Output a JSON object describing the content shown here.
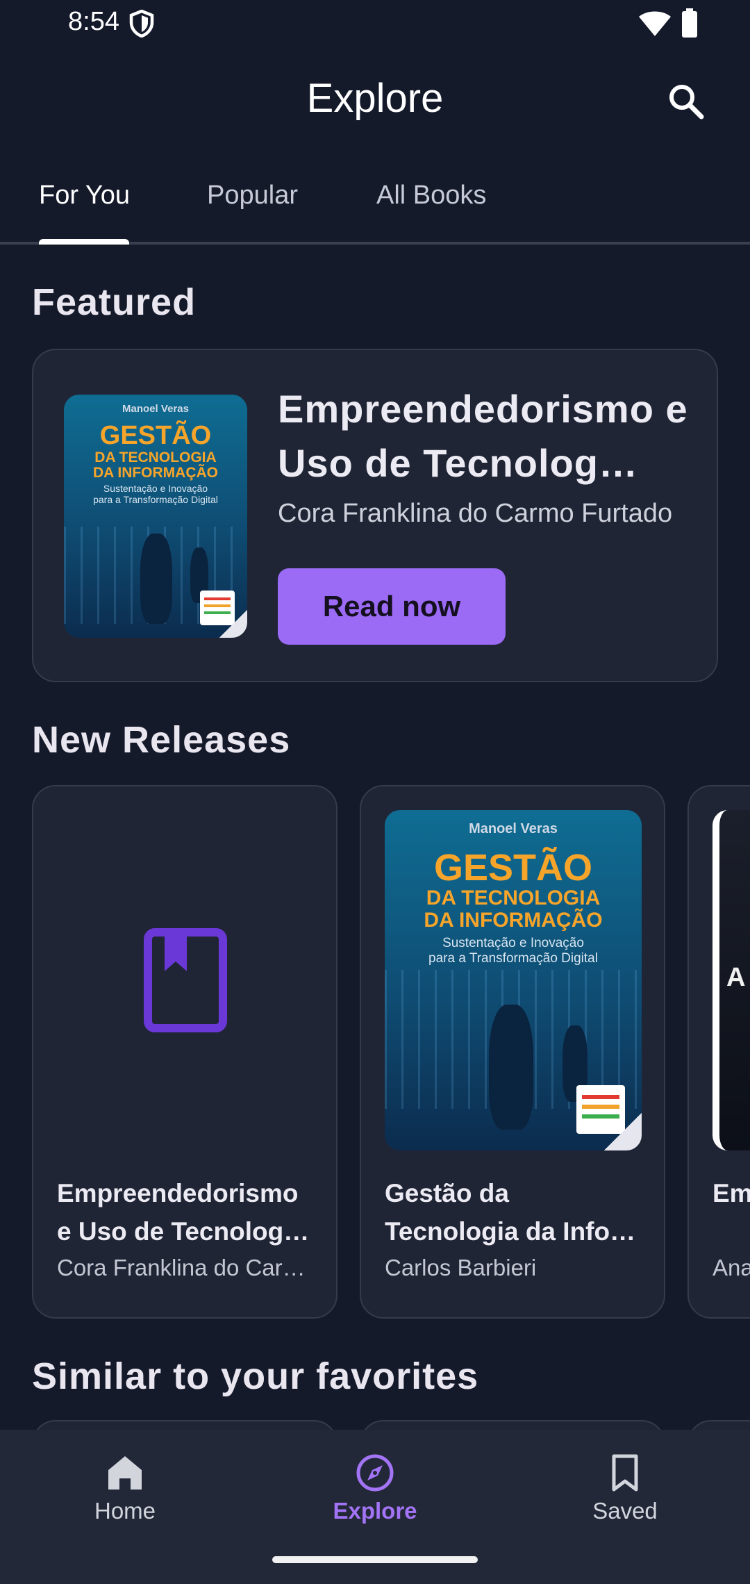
{
  "status_bar": {
    "time": "8:54"
  },
  "header": {
    "title": "Explore"
  },
  "tabs": [
    {
      "label": "For You",
      "active": true
    },
    {
      "label": "Popular",
      "active": false
    },
    {
      "label": "All Books",
      "active": false
    }
  ],
  "sections": {
    "featured": "Featured",
    "new_releases": "New Releases",
    "similar": "Similar to your favorites"
  },
  "cover_art": {
    "author": "Manoel Veras",
    "title_line1": "GESTÃO",
    "title_line2": "DA TECNOLOGIA",
    "title_line3": "DA INFORMAÇÃO",
    "subtitle_line1": "Sustentação e Inovação",
    "subtitle_line2": "para a Transformação Digital"
  },
  "featured": {
    "title": "Empreendedorismo e Uso de Tecnolog…",
    "author": "Cora Franklina do Carmo Furtado",
    "button_label": "Read now"
  },
  "new_releases": [
    {
      "title": "Empreendedorismo e Uso de Tecnolog…",
      "author": "Cora Franklina do Car…",
      "cover": "placeholder-book-icon"
    },
    {
      "title": "Gestão da Tecnologia da Info…",
      "author": "Carlos Barbieri",
      "cover": "image"
    },
    {
      "title": "Em Tec",
      "author": "Ana",
      "cover_text": "A CO"
    }
  ],
  "bottom_nav": [
    {
      "label": "Home",
      "icon": "home-icon",
      "active": false
    },
    {
      "label": "Explore",
      "icon": "compass-icon",
      "active": true
    },
    {
      "label": "Saved",
      "icon": "bookmark-icon",
      "active": false
    }
  ],
  "colors": {
    "background": "#151a2b",
    "card": "#1f2535",
    "accent": "#9b6bf5",
    "active_nav": "#a374f5"
  }
}
